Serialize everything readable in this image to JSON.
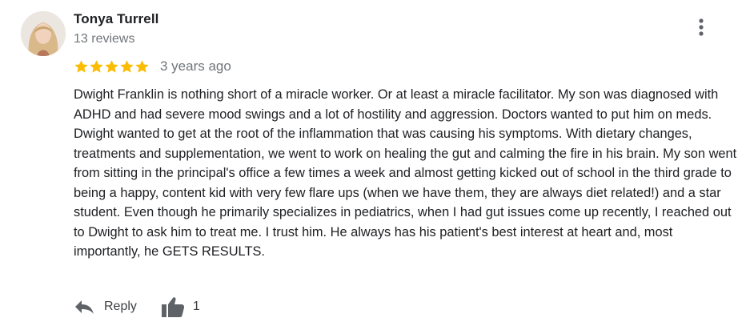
{
  "review": {
    "reviewer_name": "Tonya Turrell",
    "review_count": "13 reviews",
    "rating": 5,
    "rating_max": 5,
    "star_color": "#fbbc04",
    "date": "3 years ago",
    "text": "Dwight Franklin is nothing short of a miracle worker. Or at least a miracle facilitator. My son was diagnosed with ADHD and had severe mood swings and a lot of hostility and aggression. Doctors wanted to put him on meds. Dwight wanted to get at the root of the inflammation that was causing his symptoms. With dietary changes, treatments and supplementation, we went to work on healing the gut and calming the fire in his brain. My son went from sitting in the principal's office a few times a week and almost getting kicked out of school in the third grade to being a happy, content kid with very few flare ups (when we have them, they are always diet related!) and a star student. Even though he primarily specializes in pediatrics, when I had gut issues come up recently, I reached out to Dwight to ask him to treat me. I trust him. He always has his patient's best interest at heart and, most importantly, he GETS RESULTS."
  },
  "actions": {
    "reply_label": "Reply",
    "like_count": "1",
    "reply_icon": "reply-arrow-icon",
    "like_icon": "thumbs-up-icon",
    "more_icon": "more-vertical-icon"
  }
}
